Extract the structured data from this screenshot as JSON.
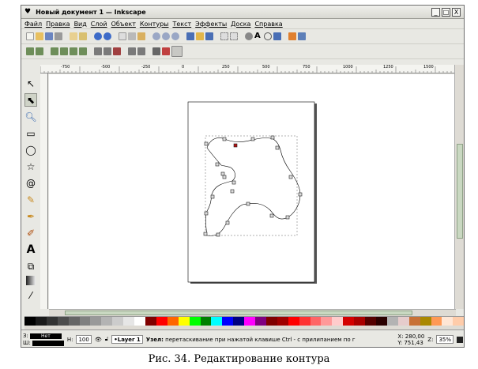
{
  "window": {
    "title": "Новый документ 1 — Inkscape",
    "buttons": [
      "_",
      "□",
      "X"
    ]
  },
  "menu": [
    "Файл",
    "Правка",
    "Вид",
    "Слой",
    "Объект",
    "Контуры",
    "Текст",
    "Эффекты",
    "Доска",
    "Справка"
  ],
  "ruler_ticks": [
    "-750",
    "-500",
    "-250",
    "0",
    "250",
    "500",
    "750",
    "1000",
    "1250",
    "1500"
  ],
  "status": {
    "fill_label": "З:",
    "stroke_label": "Ш:",
    "fill_value": "Нет",
    "stroke_width_label": "Н:",
    "opacity_value": "100",
    "layer": "•Layer 1",
    "message_bold": "Узел:",
    "message": " перетаскивание при нажатой клавише Ctrl - с прилипанием по г",
    "coord_x": "X: 280,00",
    "coord_y": "Y: 751,43",
    "zoom_label": "Z:",
    "zoom": "35%"
  },
  "caption": "Рис. 34. Редактирование контура",
  "palette": [
    "#000000",
    "#1a1a1a",
    "#333333",
    "#4d4d4d",
    "#666666",
    "#808080",
    "#999999",
    "#b3b3b3",
    "#cccccc",
    "#e6e6e6",
    "#ffffff",
    "#800000",
    "#ff0000",
    "#ff6600",
    "#ffff00",
    "#00ff00",
    "#008000",
    "#00ffff",
    "#0000ff",
    "#000080",
    "#ff00ff",
    "#800080",
    "#800000",
    "#a00000",
    "#ff0000",
    "#ff3333",
    "#ff6666",
    "#ff9999",
    "#ffcccc",
    "#d40000",
    "#aa0000",
    "#550000",
    "#2b0000",
    "#b3b3b3",
    "#e6cccc",
    "#c87137",
    "#aa8800",
    "#ff9955",
    "#ffe6d5",
    "#ffccaa"
  ]
}
